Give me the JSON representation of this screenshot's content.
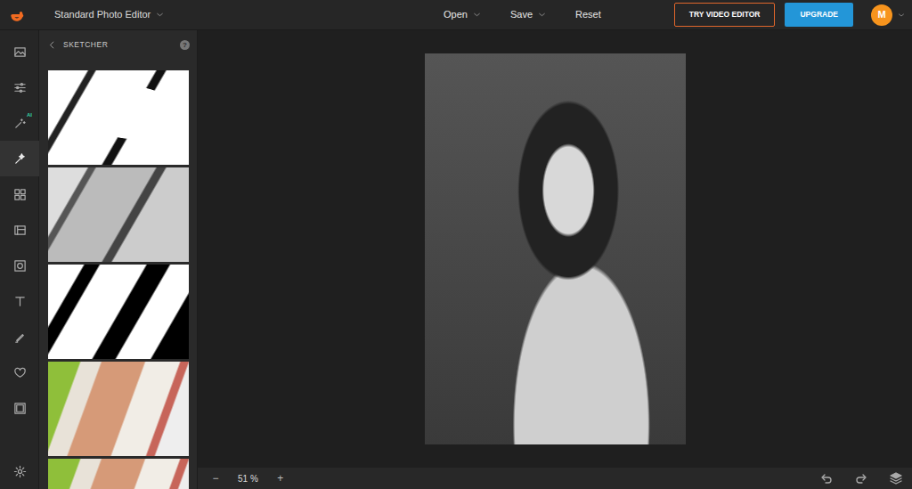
{
  "app": {
    "title": "Standard Photo Editor"
  },
  "menu": [
    {
      "label": "Open",
      "dropdown": true
    },
    {
      "label": "Save",
      "dropdown": true
    },
    {
      "label": "Reset",
      "dropdown": false
    }
  ],
  "actions": {
    "try_video": "TRY VIDEO EDITOR",
    "upgrade": "UPGRADE"
  },
  "user": {
    "initial": "M"
  },
  "rail": [
    {
      "selected": false
    },
    {
      "selected": false
    },
    {
      "selected": false,
      "badge": "AI"
    },
    {
      "selected": true
    },
    {
      "selected": false
    },
    {
      "selected": false
    },
    {
      "selected": false
    },
    {
      "selected": false
    },
    {
      "selected": false
    },
    {
      "selected": false
    },
    {
      "selected": false
    }
  ],
  "panel": {
    "title": "SKETCHER",
    "help": "?"
  },
  "presets": [
    {
      "kind": "ink"
    },
    {
      "kind": "gray"
    },
    {
      "kind": "heavy"
    },
    {
      "kind": "color"
    },
    {
      "kind": "color"
    }
  ],
  "zoom": {
    "minus": "−",
    "value": "51 %",
    "plus": "+"
  }
}
